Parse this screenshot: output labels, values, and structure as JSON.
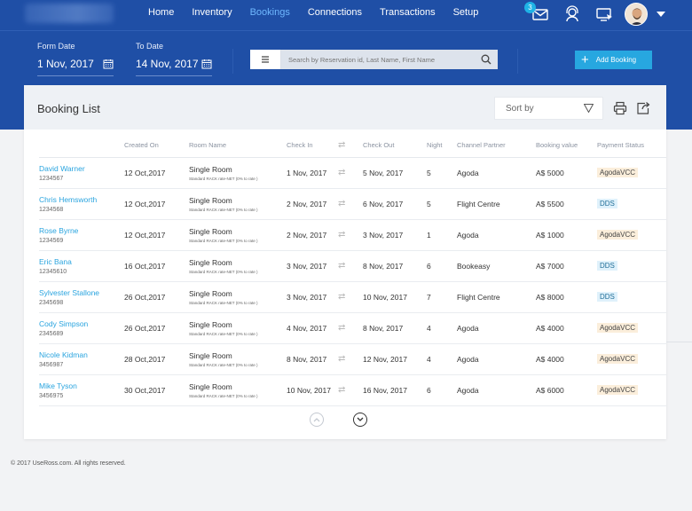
{
  "nav": {
    "items": [
      {
        "label": "Home",
        "active": false
      },
      {
        "label": "Inventory",
        "active": false
      },
      {
        "label": "Bookings",
        "active": true
      },
      {
        "label": "Connections",
        "active": false
      },
      {
        "label": "Transactions",
        "active": false
      },
      {
        "label": "Setup",
        "active": false
      }
    ],
    "notification_count": "3"
  },
  "filters": {
    "from_label": "Form Date",
    "from_value": "1 Nov, 2017",
    "to_label": "To Date",
    "to_value": "14 Nov, 2017"
  },
  "search": {
    "placeholder": "Search by Reservation id, Last Name, First Name"
  },
  "actions": {
    "add_booking": "Add Booking"
  },
  "booking_list": {
    "title": "Booking List",
    "sort_label": "Sort by",
    "columns": [
      "",
      "Created On",
      "Room Name",
      "Check In",
      "",
      "Check Out",
      "Night",
      "Channel Partner",
      "Booking value",
      "Payment Status"
    ],
    "rows": [
      {
        "guest": "David Warner",
        "id": "1234567",
        "created": "12 Oct,2017",
        "room": "Single Room",
        "rate": "Standard RACK rate-NET (0% to rate )",
        "checkin": "1 Nov, 2017",
        "checkout": "5 Nov, 2017",
        "nights": "5",
        "partner": "Agoda",
        "value": "A$ 5000",
        "status": "AgodaVCC"
      },
      {
        "guest": "Chris Hemsworth",
        "id": "1234568",
        "created": "12 Oct,2017",
        "room": "Single Room",
        "rate": "Standard RACK rate-NET (0% to rate )",
        "checkin": "2 Nov, 2017",
        "checkout": "6 Nov, 2017",
        "nights": "5",
        "partner": "Flight Centre",
        "value": "A$ 5500",
        "status": "DDS"
      },
      {
        "guest": "Rose Byrne",
        "id": "1234569",
        "created": "12 Oct,2017",
        "room": "Single Room",
        "rate": "Standard RACK rate-NET (0% to rate )",
        "checkin": "2 Nov, 2017",
        "checkout": "3 Nov, 2017",
        "nights": "1",
        "partner": "Agoda",
        "value": "A$ 1000",
        "status": "AgodaVCC"
      },
      {
        "guest": "Eric Bana",
        "id": "12345610",
        "created": "16 Oct,2017",
        "room": "Single Room",
        "rate": "Standard RACK rate-NET (0% to rate )",
        "checkin": "3 Nov, 2017",
        "checkout": "8 Nov, 2017",
        "nights": "6",
        "partner": "Bookeasy",
        "value": "A$ 7000",
        "status": "DDS"
      },
      {
        "guest": "Sylvester Stallone",
        "id": "2345698",
        "created": "26 Oct,2017",
        "room": "Single Room",
        "rate": "Standard RACK rate-NET (0% to rate )",
        "checkin": "3 Nov, 2017",
        "checkout": "10 Nov, 2017",
        "nights": "7",
        "partner": "Flight Centre",
        "value": "A$ 8000",
        "status": "DDS"
      },
      {
        "guest": "Cody Simpson",
        "id": "2345689",
        "created": "26 Oct,2017",
        "room": "Single Room",
        "rate": "Standard RACK rate-NET (0% to rate )",
        "checkin": "4 Nov, 2017",
        "checkout": "8 Nov, 2017",
        "nights": "4",
        "partner": "Agoda",
        "value": "A$ 4000",
        "status": "AgodaVCC"
      },
      {
        "guest": "Nicole Kidman",
        "id": "3456987",
        "created": "28 Oct,2017",
        "room": "Single Room",
        "rate": "Standard RACK rate-NET (0% to rate )",
        "checkin": "8 Nov, 2017",
        "checkout": "12 Nov, 2017",
        "nights": "4",
        "partner": "Agoda",
        "value": "A$ 4000",
        "status": "AgodaVCC"
      },
      {
        "guest": "Mike Tyson",
        "id": "3456975",
        "created": "30 Oct,2017",
        "room": "Single Room",
        "rate": "Standard RACK rate-NET (0% to rate )",
        "checkin": "10 Nov, 2017",
        "checkout": "16 Nov, 2017",
        "nights": "6",
        "partner": "Agoda",
        "value": "A$ 6000",
        "status": "AgodaVCC"
      }
    ]
  },
  "footer": {
    "text": "© 2017 UseRoss.com. All rights reserved."
  },
  "colors": {
    "header_blue": "#1f4fa6",
    "accent": "#27a7e0",
    "link": "#29a4df"
  }
}
